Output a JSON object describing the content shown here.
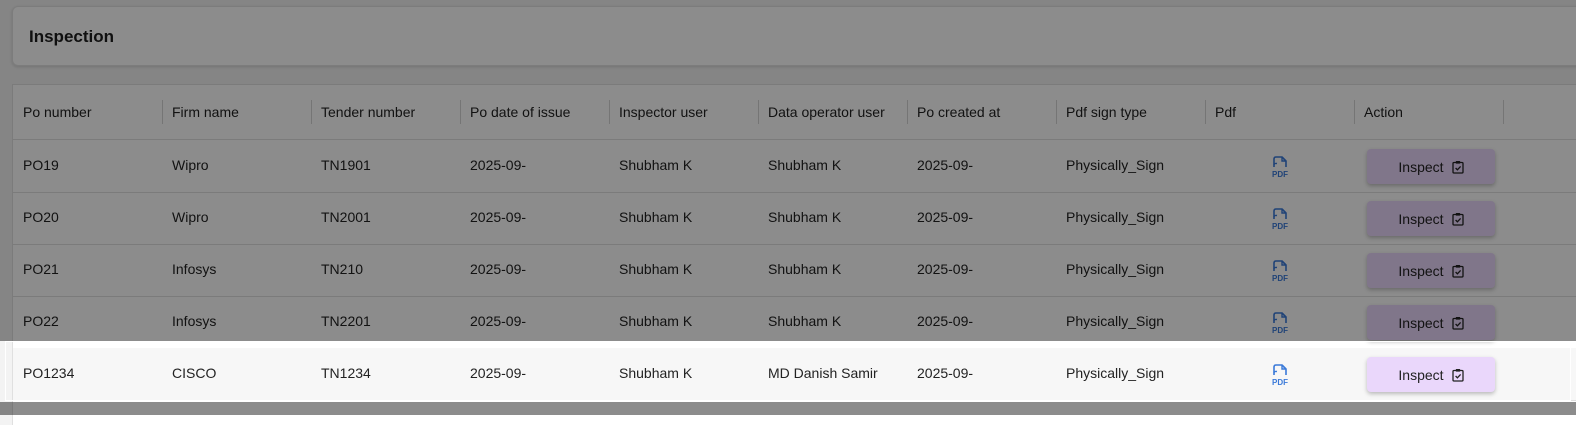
{
  "page": {
    "title": "Inspection"
  },
  "table": {
    "columns": [
      "Po number",
      "Firm name",
      "Tender number",
      "Po date of issue",
      "Inspector user",
      "Data operator user",
      "Po created at",
      "Pdf sign type",
      "Pdf",
      "Action"
    ],
    "rows": [
      {
        "po_number": "PO19",
        "firm_name": "Wipro",
        "tender_number": "TN1901",
        "po_date_of_issue": "2025-09-",
        "inspector_user": "Shubham K",
        "data_operator_user": "Shubham K",
        "po_created_at": "2025-09-",
        "pdf_sign_type": "Physically_Sign",
        "pdf_icon": "pdf-file-icon",
        "action_label": "Inspect"
      },
      {
        "po_number": "PO20",
        "firm_name": "Wipro",
        "tender_number": "TN2001",
        "po_date_of_issue": "2025-09-",
        "inspector_user": "Shubham K",
        "data_operator_user": "Shubham K",
        "po_created_at": "2025-09-",
        "pdf_sign_type": "Physically_Sign",
        "pdf_icon": "pdf-file-icon",
        "action_label": "Inspect"
      },
      {
        "po_number": "PO21",
        "firm_name": "Infosys",
        "tender_number": "TN210",
        "po_date_of_issue": "2025-09-",
        "inspector_user": "Shubham K",
        "data_operator_user": "Shubham K",
        "po_created_at": "2025-09-",
        "pdf_sign_type": "Physically_Sign",
        "pdf_icon": "pdf-file-icon",
        "action_label": "Inspect"
      },
      {
        "po_number": "PO22",
        "firm_name": "Infosys",
        "tender_number": "TN2201",
        "po_date_of_issue": "2025-09-",
        "inspector_user": "Shubham K",
        "data_operator_user": "Shubham K",
        "po_created_at": "2025-09-",
        "pdf_sign_type": "Physically_Sign",
        "pdf_icon": "pdf-file-icon",
        "action_label": "Inspect"
      },
      {
        "po_number": "PO1234",
        "firm_name": "CISCO",
        "tender_number": "TN1234",
        "po_date_of_issue": "2025-09-",
        "inspector_user": "Shubham K",
        "data_operator_user": "MD Danish Samir",
        "po_created_at": "2025-09-",
        "pdf_sign_type": "Physically_Sign",
        "pdf_icon": "pdf-file-icon",
        "action_label": "Inspect"
      }
    ]
  },
  "colors": {
    "button_bg": "#ead7fb",
    "pdf_icon": "#3b7ad9",
    "overlay": "#000000"
  },
  "icons": {
    "action_icon": "clipboard-check-icon"
  }
}
